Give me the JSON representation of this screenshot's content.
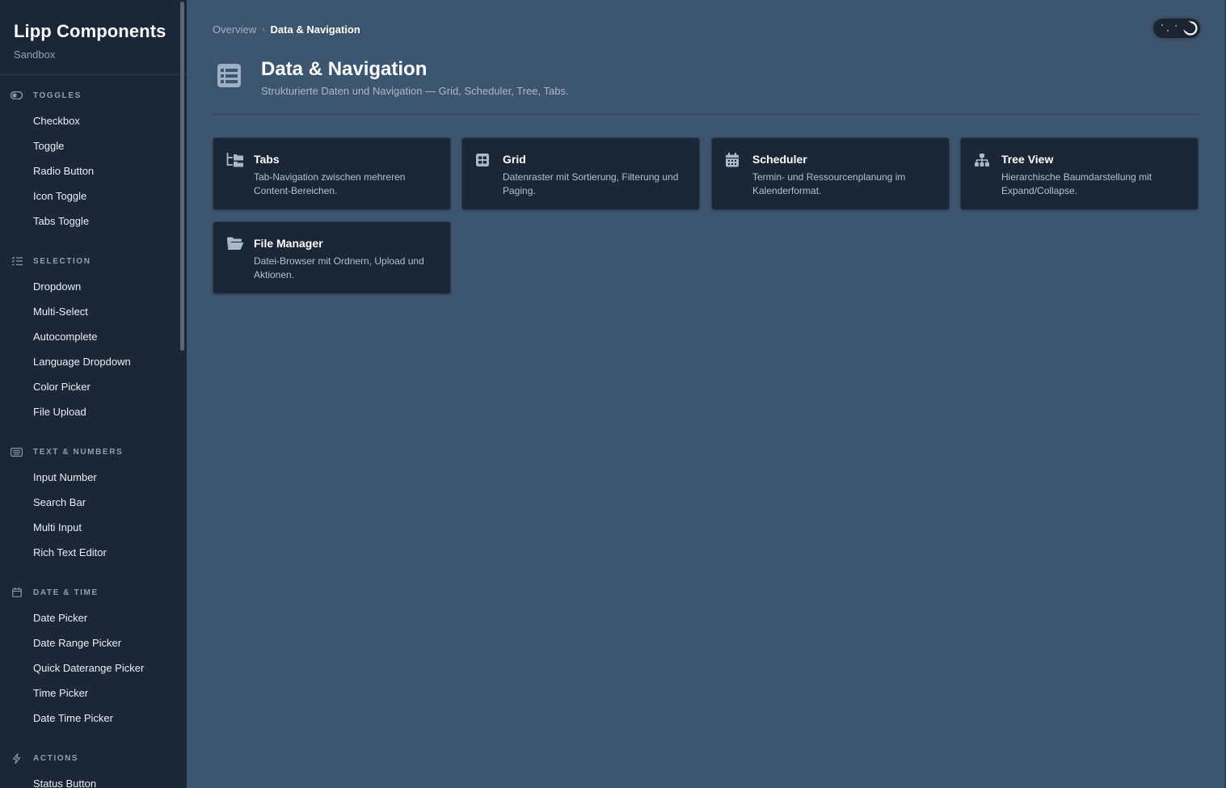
{
  "sidebar": {
    "brand_title": "Lipp Components",
    "brand_subtitle": "Sandbox",
    "sections": [
      {
        "label": "Toggles",
        "icon": "toggle-icon",
        "items": [
          "Checkbox",
          "Toggle",
          "Radio Button",
          "Icon Toggle",
          "Tabs Toggle"
        ]
      },
      {
        "label": "Selection",
        "icon": "list-check-icon",
        "items": [
          "Dropdown",
          "Multi-Select",
          "Autocomplete",
          "Language Dropdown",
          "Color Picker",
          "File Upload"
        ]
      },
      {
        "label": "Text & Numbers",
        "icon": "keyboard-icon",
        "items": [
          "Input Number",
          "Search Bar",
          "Multi Input",
          "Rich Text Editor"
        ]
      },
      {
        "label": "Date & Time",
        "icon": "calendar-icon",
        "items": [
          "Date Picker",
          "Date Range Picker",
          "Quick Daterange Picker",
          "Time Picker",
          "Date Time Picker"
        ]
      },
      {
        "label": "Actions",
        "icon": "bolt-icon",
        "items": [
          "Status Button"
        ]
      }
    ]
  },
  "breadcrumb": {
    "parent": "Overview",
    "separator": "›",
    "current": "Data & Navigation"
  },
  "header": {
    "title": "Data & Navigation",
    "subtitle": "Strukturierte Daten und Navigation — Grid, Scheduler, Tree, Tabs.",
    "icon": "table-list-icon"
  },
  "theme_toggle": {
    "state": "dark",
    "icon": "moon-icon"
  },
  "cards": [
    {
      "title": "Tabs",
      "icon": "folder-tree-icon",
      "description": "Tab-Navigation zwischen mehreren Content-Bereichen."
    },
    {
      "title": "Grid",
      "icon": "grid-table-icon",
      "description": "Datenraster mit Sortierung, Filterung und Paging."
    },
    {
      "title": "Scheduler",
      "icon": "calendar-days-icon",
      "description": "Termin- und Ressourcenplanung im Kalenderformat."
    },
    {
      "title": "Tree View",
      "icon": "sitemap-icon",
      "description": "Hierarchische Baumdarstellung mit Expand/Collapse."
    },
    {
      "title": "File Manager",
      "icon": "folder-open-icon",
      "description": "Datei-Browser mit Ordnern, Upload und Aktionen."
    }
  ],
  "colors": {
    "sidebar_bg": "#1b2636",
    "main_bg": "#3d5670",
    "card_bg": "#1b2636"
  }
}
